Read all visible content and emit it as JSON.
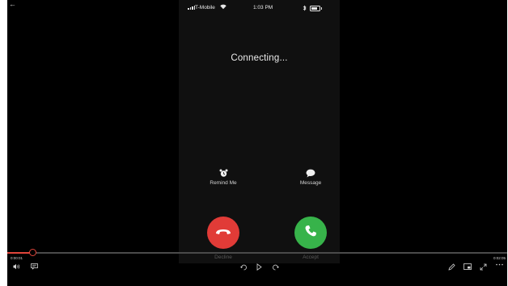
{
  "player": {
    "back_icon": "back-arrow-icon",
    "current_time": "0:00:01",
    "total_time": "0:02:05",
    "progress": 0.05,
    "accent_color": "#e0453b",
    "controls": {
      "left": [
        "volume-icon",
        "captions-icon"
      ],
      "center": [
        "skip-back-icon",
        "play-icon",
        "skip-forward-icon"
      ],
      "right": [
        "edit-pen-icon",
        "miniplayer-icon",
        "fullscreen-icon",
        "more-icon"
      ]
    }
  },
  "phone": {
    "status_bar": {
      "carrier": "T-Mobile",
      "time": "1:03 PM"
    },
    "call_status": "Connecting...",
    "options": [
      {
        "label": "Remind Me",
        "icon": "alarm-clock-icon"
      },
      {
        "label": "Message",
        "icon": "message-bubble-icon"
      }
    ],
    "decline_label": "Decline",
    "accept_label": "Accept",
    "decline_color": "#e13b37",
    "accept_color": "#37b34a"
  }
}
